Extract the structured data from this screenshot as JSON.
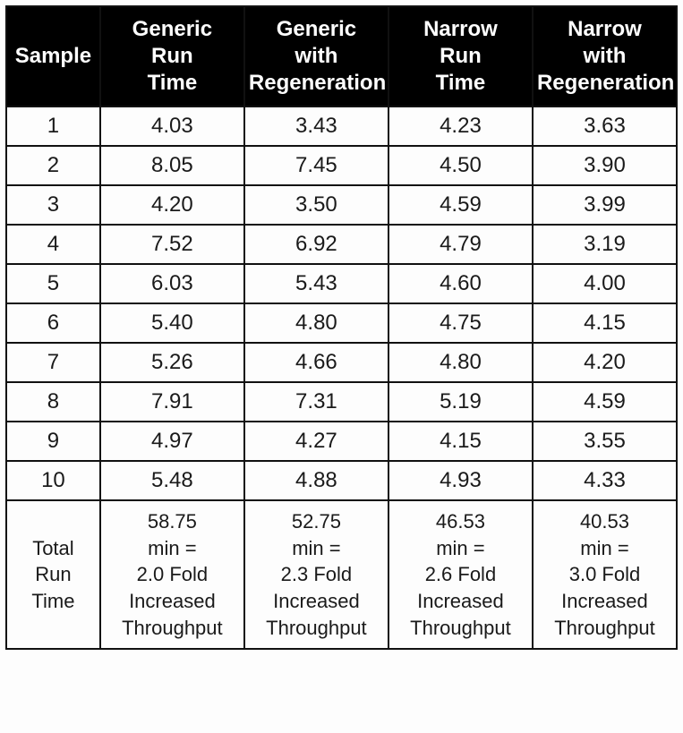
{
  "chart_data": {
    "type": "table",
    "title": "",
    "columns": [
      "Sample",
      "Generic Run Time",
      "Generic with Regeneration",
      "Narrow Run Time",
      "Narrow with Regeneration"
    ],
    "rows": [
      [
        "1",
        4.03,
        3.43,
        4.23,
        3.63
      ],
      [
        "2",
        8.05,
        7.45,
        4.5,
        3.9
      ],
      [
        "3",
        4.2,
        3.5,
        4.59,
        3.99
      ],
      [
        "4",
        7.52,
        6.92,
        4.79,
        3.19
      ],
      [
        "5",
        6.03,
        5.43,
        4.6,
        4.0
      ],
      [
        "6",
        5.4,
        4.8,
        4.75,
        4.15
      ],
      [
        "7",
        5.26,
        4.66,
        4.8,
        4.2
      ],
      [
        "8",
        7.91,
        7.31,
        5.19,
        4.59
      ],
      [
        "9",
        4.97,
        4.27,
        4.15,
        3.55
      ],
      [
        "10",
        5.48,
        4.88,
        4.93,
        4.33
      ]
    ],
    "totals_min": [
      58.75,
      52.75,
      46.53,
      40.53
    ],
    "fold_increase": [
      2.0,
      2.3,
      2.6,
      3.0
    ]
  },
  "headers": {
    "sample": "Sample",
    "col1": {
      "l1": "Generic",
      "l2": "Run",
      "l3": "Time"
    },
    "col2": {
      "l1": "Generic",
      "l2": "with",
      "l3": "Regeneration"
    },
    "col3": {
      "l1": "Narrow",
      "l2": "Run",
      "l3": "Time"
    },
    "col4": {
      "l1": "Narrow",
      "l2": "with",
      "l3": "Regeneration"
    }
  },
  "rows": {
    "r1": {
      "s": "1",
      "c1": "4.03",
      "c2": "3.43",
      "c3": "4.23",
      "c4": "3.63"
    },
    "r2": {
      "s": "2",
      "c1": "8.05",
      "c2": "7.45",
      "c3": "4.50",
      "c4": "3.90"
    },
    "r3": {
      "s": "3",
      "c1": "4.20",
      "c2": "3.50",
      "c3": "4.59",
      "c4": "3.99"
    },
    "r4": {
      "s": "4",
      "c1": "7.52",
      "c2": "6.92",
      "c3": "4.79",
      "c4": "3.19"
    },
    "r5": {
      "s": "5",
      "c1": "6.03",
      "c2": "5.43",
      "c3": "4.60",
      "c4": "4.00"
    },
    "r6": {
      "s": "6",
      "c1": "5.40",
      "c2": "4.80",
      "c3": "4.75",
      "c4": "4.15"
    },
    "r7": {
      "s": "7",
      "c1": "5.26",
      "c2": "4.66",
      "c3": "4.80",
      "c4": "4.20"
    },
    "r8": {
      "s": "8",
      "c1": "7.91",
      "c2": "7.31",
      "c3": "5.19",
      "c4": "4.59"
    },
    "r9": {
      "s": "9",
      "c1": "4.97",
      "c2": "4.27",
      "c3": "4.15",
      "c4": "3.55"
    },
    "r10": {
      "s": "10",
      "c1": "5.48",
      "c2": "4.88",
      "c3": "4.93",
      "c4": "4.33"
    }
  },
  "summary": {
    "label": {
      "l1": "Total",
      "l2": "Run",
      "l3": "Time"
    },
    "c1": {
      "l1": "58.75",
      "l2": "min =",
      "l3": "2.0 Fold",
      "l4": "Increased",
      "l5": "Throughput"
    },
    "c2": {
      "l1": "52.75",
      "l2": "min =",
      "l3": "2.3 Fold",
      "l4": "Increased",
      "l5": "Throughput"
    },
    "c3": {
      "l1": "46.53",
      "l2": "min =",
      "l3": "2.6 Fold",
      "l4": "Increased",
      "l5": "Throughput"
    },
    "c4": {
      "l1": "40.53",
      "l2": "min =",
      "l3": "3.0 Fold",
      "l4": "Increased",
      "l5": "Throughput"
    }
  }
}
